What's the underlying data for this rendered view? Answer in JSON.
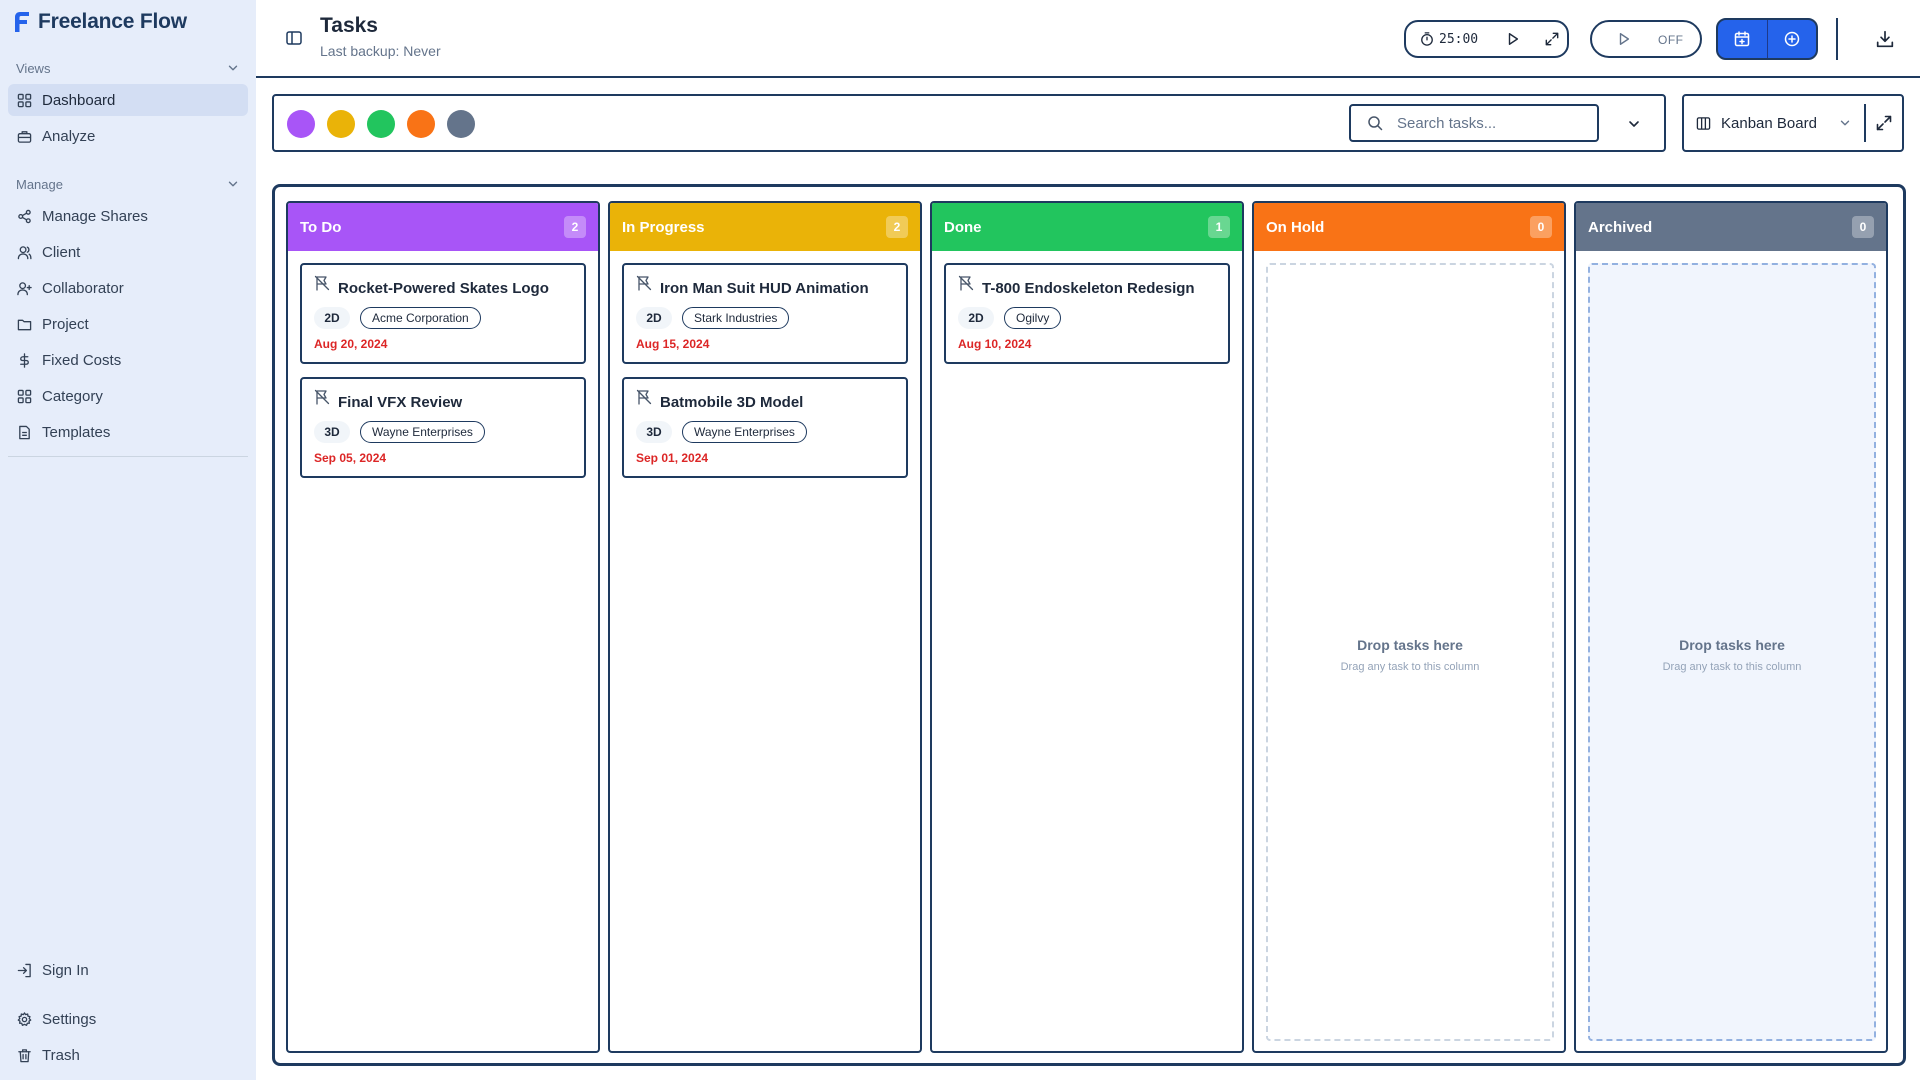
{
  "app": {
    "name": "Freelance Flow"
  },
  "sidebar": {
    "views_label": "Views",
    "manage_label": "Manage",
    "views_items": [
      {
        "label": "Dashboard",
        "icon": "grid-icon",
        "active": true
      },
      {
        "label": "Analyze",
        "icon": "briefcase-icon"
      }
    ],
    "manage_items": [
      {
        "label": "Manage Shares",
        "icon": "share-icon"
      },
      {
        "label": "Client",
        "icon": "user-icon"
      },
      {
        "label": "Collaborator",
        "icon": "user-plus-icon"
      },
      {
        "label": "Project",
        "icon": "folder-icon"
      },
      {
        "label": "Fixed Costs",
        "icon": "dollar-icon"
      },
      {
        "label": "Category",
        "icon": "grid-icon"
      },
      {
        "label": "Templates",
        "icon": "file-icon"
      }
    ],
    "footer_items": [
      {
        "label": "Sign In",
        "icon": "log-in-icon"
      },
      {
        "label": "Settings",
        "icon": "gear-icon"
      },
      {
        "label": "Trash",
        "icon": "trash-icon"
      }
    ]
  },
  "header": {
    "title": "Tasks",
    "backup_text": "Last backup: Never",
    "timer": "25:00",
    "tracking_state": "OFF"
  },
  "filters": {
    "status_dots": [
      "#a855f7",
      "#eab308",
      "#22c55e",
      "#f97316",
      "#64748b"
    ],
    "search_placeholder": "Search tasks...",
    "search_value": "",
    "view_mode": "Kanban Board"
  },
  "board": {
    "columns": [
      {
        "title": "To Do",
        "count": "2",
        "color": "#a855f7",
        "tasks": [
          {
            "title": "Rocket-Powered Skates Logo",
            "type": "2D",
            "client": "Acme Corporation",
            "date": "Aug 20, 2024"
          },
          {
            "title": "Final VFX Review",
            "type": "3D",
            "client": "Wayne Enterprises",
            "date": "Sep 05, 2024"
          }
        ]
      },
      {
        "title": "In Progress",
        "count": "2",
        "color": "#eab308",
        "tasks": [
          {
            "title": "Iron Man Suit HUD Animation",
            "type": "2D",
            "client": "Stark Industries",
            "date": "Aug 15, 2024"
          },
          {
            "title": "Batmobile 3D Model",
            "type": "3D",
            "client": "Wayne Enterprises",
            "date": "Sep 01, 2024"
          }
        ]
      },
      {
        "title": "Done",
        "count": "1",
        "color": "#22c55e",
        "tasks": [
          {
            "title": "T-800 Endoskeleton Redesign",
            "type": "2D",
            "client": "Ogilvy",
            "date": "Aug 10, 2024"
          }
        ]
      },
      {
        "title": "On Hold",
        "count": "0",
        "color": "#f97316",
        "tasks": [],
        "empty_title": "Drop tasks here",
        "empty_subtitle": "Drag any task to this column"
      },
      {
        "title": "Archived",
        "count": "0",
        "color": "#64748b",
        "tasks": [],
        "empty_title": "Drop tasks here",
        "empty_subtitle": "Drag any task to this column"
      }
    ]
  }
}
